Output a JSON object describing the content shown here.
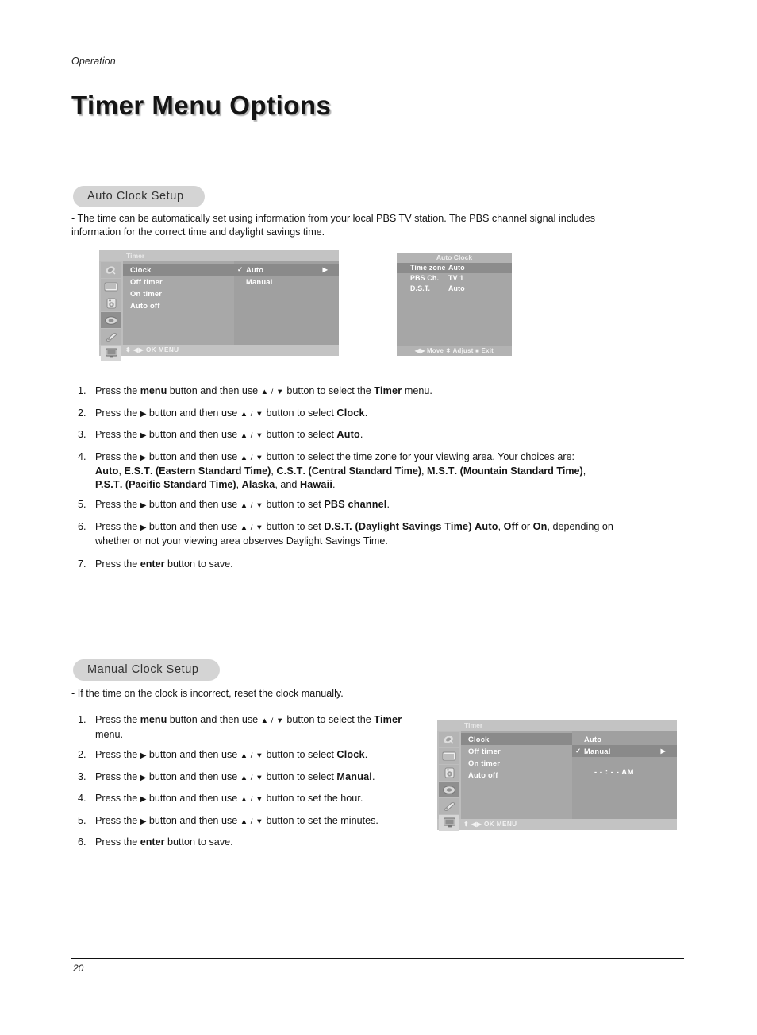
{
  "header": {
    "label": "Operation"
  },
  "title": "Timer Menu Options",
  "section1": {
    "pill": "Auto Clock Setup",
    "intro": "- The time can be automatically set using information from your local PBS TV station. The PBS channel signal includes information for the correct time and daylight savings time.",
    "steps": [
      {
        "num": "1.",
        "text_a": "Press the ",
        "b1": "menu",
        "text_b": " button and then use ",
        "ud": "▲ / ▼",
        "text_c": " button to select the ",
        "b2": "Timer",
        "text_d": " menu."
      },
      {
        "num": "2.",
        "text_a": "Press the ",
        "arrow": "▶",
        "text_b": " button and then use ",
        "ud": "▲ / ▼",
        "text_c": " button to select ",
        "b2": "Clock",
        "text_d": "."
      },
      {
        "num": "3.",
        "text_a": "Press the ",
        "arrow": "▶",
        "text_b": " button and then use ",
        "ud": "▲ / ▼",
        "text_c": " button to select ",
        "b2": "Auto",
        "text_d": "."
      },
      {
        "num": "4.",
        "text_a": "Press the ",
        "arrow": "▶",
        "text_b": " button and then use ",
        "ud": "▲ / ▼",
        "text_c": " button to select the time zone for your viewing area. Your choices are:"
      },
      {
        "num": "5.",
        "text_a": "Press the ",
        "arrow": "▶",
        "text_b": " button and then use ",
        "ud": "▲ / ▼",
        "text_c": " button to set ",
        "b2": "PBS channel",
        "text_d": "."
      },
      {
        "num": "6.",
        "text_a": "Press the ",
        "arrow": "▶",
        "text_b": " button and then use ",
        "ud": "▲ / ▼",
        "text_c": " button to set ",
        "b2": "D.S.T. (Daylight Savings Time)",
        "text_d": " "
      },
      {
        "num": "7.",
        "text_a": "Press the ",
        "b1": "enter",
        "text_b": " button to save."
      }
    ],
    "step4_zones_line1_a": "Auto",
    "step4_zones_line1_b": ", ",
    "step4_zones": "Auto, E.S.T. (Eastern Standard Time), C.S.T. (Central Standard Time), M.S.T. (Mountain  Standard Time), P.S.T. (Pacific Standard Time), Alaska, and  Hawaii.",
    "zones": {
      "auto": "Auto",
      "est": "E.S.T",
      "est_full": ". (Eastern Standard Time)",
      "cst": "C.S.T",
      "cst_full": ". (Central Standard Time)",
      "mst": "M.S.T",
      "mst_full": ". (Mountain  Standard Time)",
      "pst": "P.S.T",
      "pst_full": ". (Pacific Standard Time)",
      "alaska": "Alaska",
      "hawaii": "Hawaii"
    },
    "step6_dst": {
      "auto": "Auto",
      "off": "Off",
      "on": "On",
      "or": " or ",
      "tail": ", depending on whether or not your viewing area observes Daylight Savings Time."
    }
  },
  "section2": {
    "pill": "Manual Clock Setup",
    "intro": "-  If the time on the clock is incorrect, reset the clock manually.",
    "steps": [
      {
        "num": "1.",
        "text_a": "Press the ",
        "b1": "menu",
        "text_b": " button and then use ",
        "ud": "▲ / ▼",
        "text_c": " button to select the ",
        "b2": "Timer",
        "text_d": " menu."
      },
      {
        "num": "2.",
        "text_a": "Press the ",
        "arrow": "▶",
        "text_b": " button and then use ",
        "ud": "▲ / ▼",
        "text_c": " button to select ",
        "b2": "Clock",
        "text_d": "."
      },
      {
        "num": "3.",
        "text_a": "Press the ",
        "arrow": "▶",
        "text_b": " button and then use ",
        "ud": "▲ / ▼",
        "text_c": " button to select ",
        "b2": "Manual",
        "text_d": "."
      },
      {
        "num": "4.",
        "text_a": "Press the ",
        "arrow": "▶",
        "text_b": " button and then use ",
        "ud": "▲ / ▼",
        "text_c": " button to set the hour."
      },
      {
        "num": "5.",
        "text_a": "Press the ",
        "arrow": "▶",
        "text_b": " button and then use ",
        "ud": "▲ / ▼",
        "text_c": " button to set the minutes."
      },
      {
        "num": "6.",
        "text_a": "Press the ",
        "b1": "enter",
        "text_b": " button to save."
      }
    ]
  },
  "osd_auto": {
    "title": "Timer",
    "menu_items": [
      "Clock",
      "Off timer",
      "On timer",
      "Auto off"
    ],
    "options": [
      {
        "check": "✓",
        "label": "Auto",
        "arrow": "▶",
        "selected": true
      },
      {
        "check": "",
        "label": "Manual",
        "arrow": "",
        "selected": false
      }
    ],
    "footer": "⬍ ◀▶  OK   MENU",
    "icons": [
      "satellite-dish-icon",
      "picture-icon",
      "audio-icon",
      "timer-icon",
      "special-icon",
      "screen-icon"
    ]
  },
  "osd_manual": {
    "title": "Timer",
    "menu_items": [
      "Clock",
      "Off timer",
      "On timer",
      "Auto off"
    ],
    "options": [
      {
        "check": "",
        "label": "Auto",
        "arrow": "",
        "selected": false
      },
      {
        "check": "✓",
        "label": "Manual",
        "arrow": "▶",
        "selected": true
      }
    ],
    "time_value": "- - : - -    AM",
    "footer": "⬍ ◀▶  OK   MENU"
  },
  "dialog_auto_clock": {
    "title": "Auto Clock",
    "rows": [
      {
        "key": "Time zone",
        "value": "Auto",
        "selected": true
      },
      {
        "key": "PBS Ch.",
        "value": "TV 1",
        "selected": false
      },
      {
        "key": "D.S.T.",
        "value": "Auto",
        "selected": false
      }
    ],
    "footer": "◀▶ Move ⬍ Adjust  ■ Exit"
  },
  "footer": {
    "page_number": "20"
  },
  "colors": {
    "pill_bg": "#d4d4d4",
    "osd_frame": "#c3c3c3",
    "osd_menu": "#a8a8a8",
    "osd_option": "#a0a0a0",
    "osd_highlight": "#8a8a8a",
    "text": "#141414"
  }
}
